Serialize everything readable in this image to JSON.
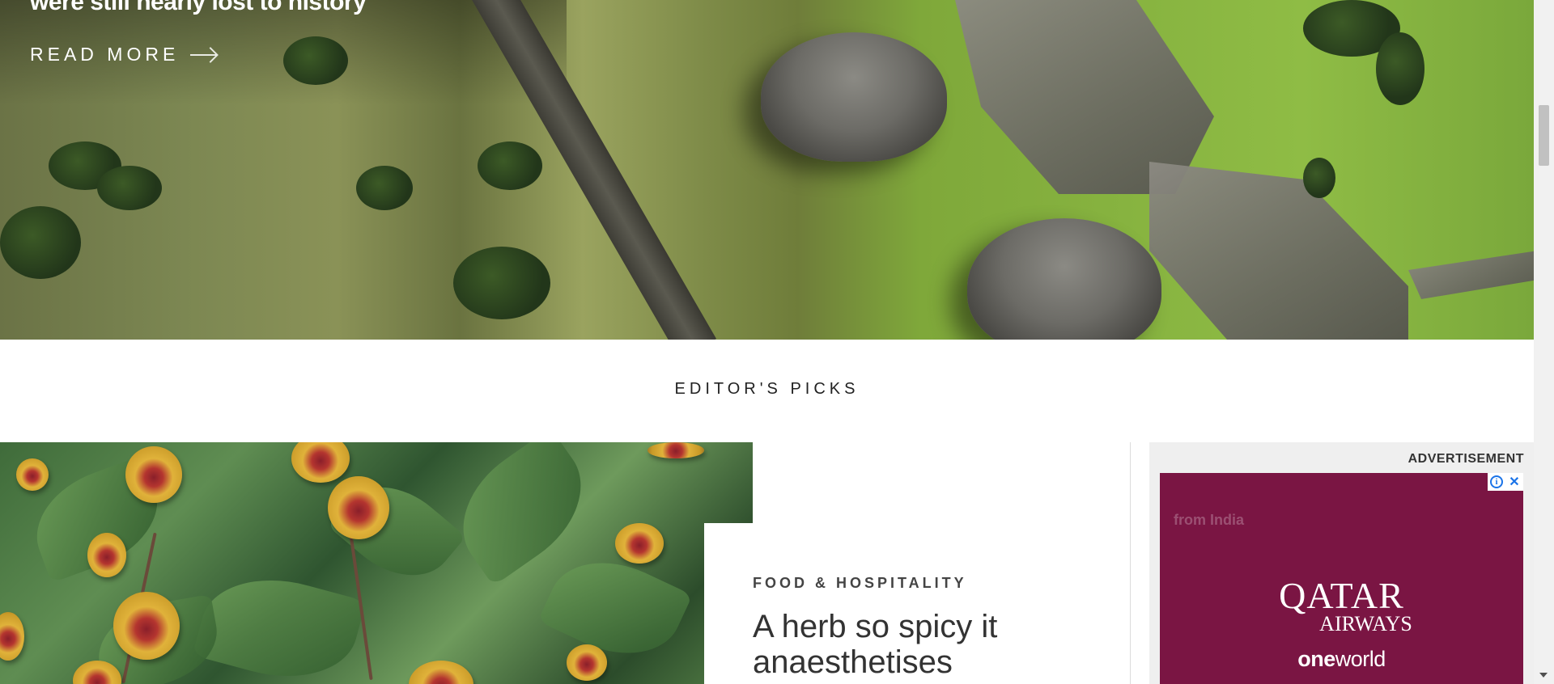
{
  "hero": {
    "title": "were still nearly lost to history",
    "read_more": "READ MORE"
  },
  "section": {
    "title": "EDITOR'S PICKS"
  },
  "feature": {
    "kicker": "FOOD & HOSPITALITY",
    "headline": "A herb so spicy it anaesthetises"
  },
  "ad": {
    "label": "ADVERTISEMENT",
    "route_text": "from India",
    "brand_main": "QATAR",
    "brand_sub": "AIRWAYS",
    "alliance_bold": "one",
    "alliance_rest": "world",
    "info_icon": "i",
    "close_icon": "✕",
    "background_color": "#7a1543"
  }
}
